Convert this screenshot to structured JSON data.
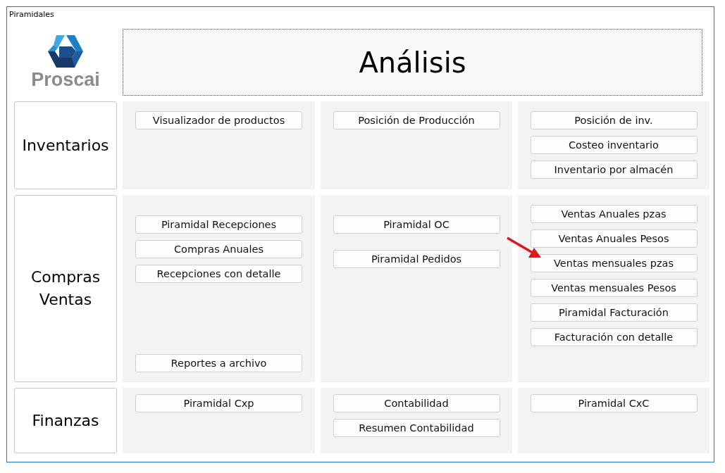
{
  "window": {
    "title": "Piramidales"
  },
  "logo": {
    "text": "Proscai"
  },
  "header": {
    "title": "Análisis"
  },
  "sections": [
    {
      "label": "Inventarios",
      "panels": [
        {
          "groups": [
            [
              "Visualizador de productos"
            ]
          ]
        },
        {
          "groups": [
            [
              "Posición de Producción"
            ]
          ]
        },
        {
          "groups": [
            [
              "Posición de inv.",
              "Costeo inventario",
              "Inventario por almacén"
            ]
          ]
        }
      ]
    },
    {
      "label": "Compras Ventas",
      "panels": [
        {
          "groups": [
            [
              "Piramidal Recepciones",
              "Compras Anuales",
              "Recepciones con detalle"
            ],
            [
              "Reportes a archivo"
            ]
          ]
        },
        {
          "groups": [
            [
              "Piramidal OC",
              "Piramidal Pedidos"
            ]
          ]
        },
        {
          "groups": [
            [
              "Ventas Anuales pzas",
              "Ventas Anuales Pesos",
              "Ventas mensuales pzas",
              "Ventas mensuales Pesos",
              "Piramidal Facturación",
              "Facturación con detalle"
            ]
          ]
        }
      ]
    },
    {
      "label": "Finanzas",
      "panels": [
        {
          "groups": [
            [
              "Piramidal Cxp"
            ]
          ]
        },
        {
          "groups": [
            [
              "Contabilidad",
              "Resumen Contabilidad"
            ]
          ]
        },
        {
          "groups": [
            [
              "Piramidal CxC"
            ]
          ]
        }
      ]
    }
  ]
}
